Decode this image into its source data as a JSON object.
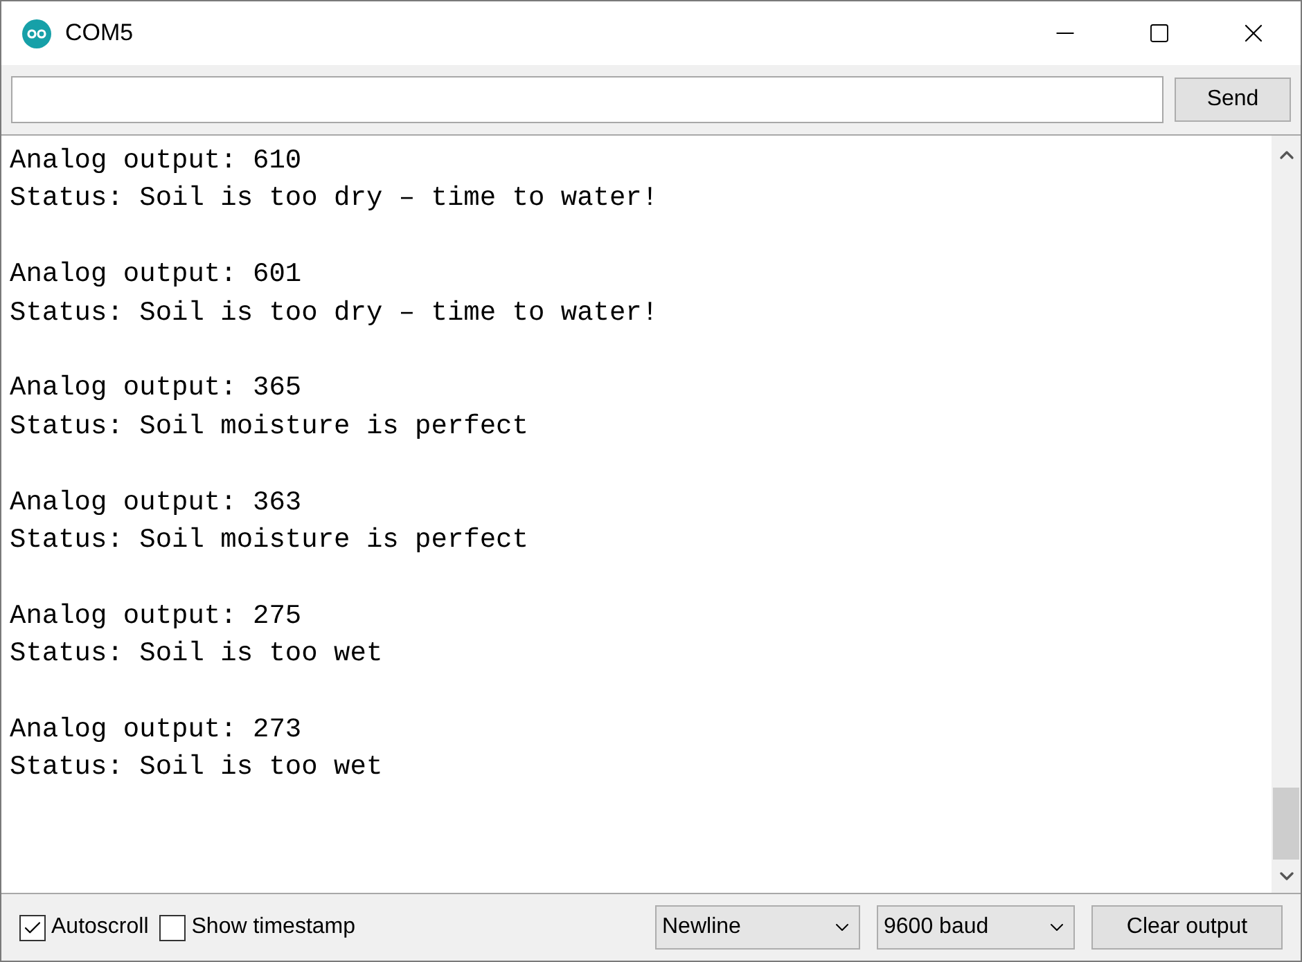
{
  "window": {
    "title": "COM5"
  },
  "send_row": {
    "button": "Send"
  },
  "output": [
    {
      "lines": [
        "Analog output: 610",
        "Status: Soil is too dry – time to water!"
      ]
    },
    {
      "lines": [
        "Analog output: 601",
        "Status: Soil is too dry – time to water!"
      ]
    },
    {
      "lines": [
        "Analog output: 365",
        "Status: Soil moisture is perfect"
      ]
    },
    {
      "lines": [
        "Analog output: 363",
        "Status: Soil moisture is perfect"
      ]
    },
    {
      "lines": [
        "Analog output: 275",
        "Status: Soil is too wet"
      ]
    },
    {
      "lines": [
        "Analog output: 273",
        "Status: Soil is too wet"
      ]
    }
  ],
  "bottom_bar": {
    "checkboxes": [
      {
        "label": "Autoscroll",
        "checked": true
      },
      {
        "label": "Show timestamp",
        "checked": false
      }
    ],
    "line_ending": "Newline",
    "baud": "9600 baud",
    "clear_button": "Clear output"
  }
}
